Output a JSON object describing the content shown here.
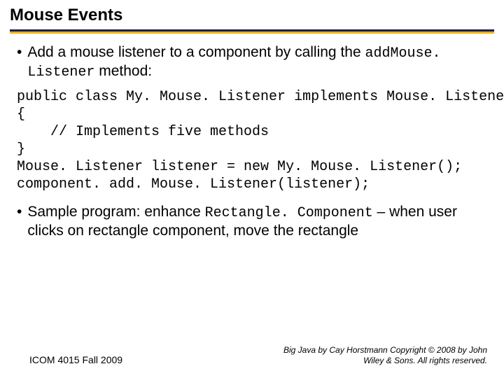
{
  "title": "Mouse Events",
  "bullet1": {
    "prefix": "Add a mouse listener to a component by calling the ",
    "code": "addMouse. Listener",
    "suffix": " method:"
  },
  "code": "public class My. Mouse. Listener implements Mouse. Listener\n{\n    // Implements five methods\n}\nMouse. Listener listener = new My. Mouse. Listener();\ncomponent. add. Mouse. Listener(listener);",
  "bullet2": {
    "prefix": "Sample program: enhance ",
    "code": "Rectangle. Component",
    "suffix": " – when user clicks on rectangle component, move the rectangle"
  },
  "footer": {
    "left": "ICOM 4015 Fall 2009",
    "right": "Big Java by Cay Horstmann Copyright © 2008 by John Wiley & Sons.  All rights reserved."
  }
}
